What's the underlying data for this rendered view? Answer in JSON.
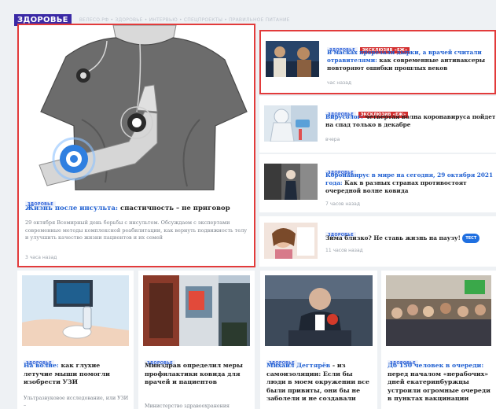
{
  "header": {
    "section_label": "ЗДОРОВЬЕ",
    "breadcrumb": "ВЕЛЕСО.РФ • ЗДОРОВЬЕ • ИНТЕРВЬЮ • СПЕЦПРОЕКТЫ • ПРАВИЛЬНОЕ ПИТАНИЕ"
  },
  "featured": {
    "tag": "ЗДОРОВЬЕ",
    "headline_link": "Жизнь после инсульта:",
    "headline_rest": " спастичность – не приговор",
    "lead": "29 октября Всемирный день борьбы с инсультом. Обсуждаем с экспертами современные методы комплексной реабилитации, как вернуть подвижность телу и улучшить качество жизни пациентов и их семей",
    "time": "3 часа назад"
  },
  "side": [
    {
      "tag": "ЗДОРОВЬЕ",
      "tag2": "ЭКСКЛЮЗИВ «ЕЖ»",
      "headline_link": "В масках прорезали дырки, а врачей считали отравителями:",
      "headline_rest": " как современные антиваксеры повторяют ошибки прошлых веков",
      "time": "час назад"
    },
    {
      "tag": "ЗДОРОВЬЕ",
      "tag2": "ЭКСКЛЮЗИВ «ЕЖ»",
      "headline_link": "Вирусолог:",
      "headline_rest": " четвертая волна коронавируса пойдет на спад только в декабре",
      "time": "вчера"
    },
    {
      "tag": "ЗДОРОВЬЕ",
      "headline_link": "Коронавирус в мире на сегодня, 29 октября 2021 года:",
      "headline_rest": " Как в разных странах противостоят очередной волне ковида",
      "time": "7 часов назад"
    },
    {
      "tag": "ЗДОРОВЬЕ",
      "headline_link": "",
      "headline_rest": "Зима близко? Не ставь жизнь на паузу!",
      "badge": "ТЕСТ",
      "time": "11 часов назад"
    }
  ],
  "bottom": [
    {
      "tag": "ЗДОРОВЬЕ",
      "headline_link": "На волне:",
      "headline_rest": " как глухие летучие мыши помогли изобрести УЗИ",
      "lead": "Ультразвуковое исследование, или УЗИ –"
    },
    {
      "tag": "ЗДОРОВЬЕ",
      "headline_link": "",
      "headline_rest": "Минздрав определил меры профилактики ковида для врачей и пациентов",
      "lead": "Министерство здравоохранения"
    },
    {
      "tag": "ЗДОРОВЬЕ",
      "headline_link": "Михаил Дегтярёв",
      "headline_rest": " - из самоизоляции: Если бы люди в моем окружении все были привиты, они бы не заболели и не создавали",
      "lead": ""
    },
    {
      "tag": "ЗДОРОВЬЕ",
      "headline_link": "До 150 человек в очереди:",
      "headline_rest": " перед началом «нерабочих» дней екатеринбуржцы устроили огромные очереди в пунктах вакцинации",
      "lead": ""
    }
  ]
}
